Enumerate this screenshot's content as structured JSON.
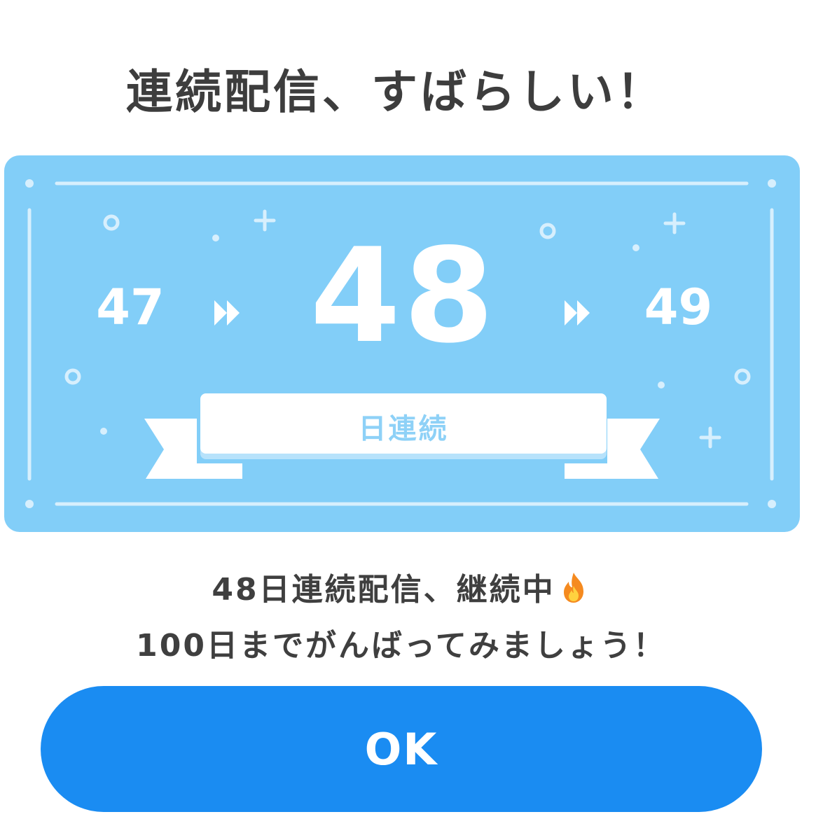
{
  "dialog": {
    "title": "連続配信、すばらしい！",
    "streak": {
      "previous": "47",
      "current": "48",
      "next": "49",
      "label": "日連続"
    },
    "message_line1": "48日連続配信、継続中",
    "message_line1_icon": "fire-icon",
    "message_line2": "100日までがんばってみましょう！",
    "ok_button": "OK"
  },
  "colors": {
    "card_background": "#82cef8",
    "card_decoration": "#d7effd",
    "ribbon_text": "#8ed1f7",
    "button_background": "#1a8cf2",
    "text": "#3f3f3f"
  }
}
